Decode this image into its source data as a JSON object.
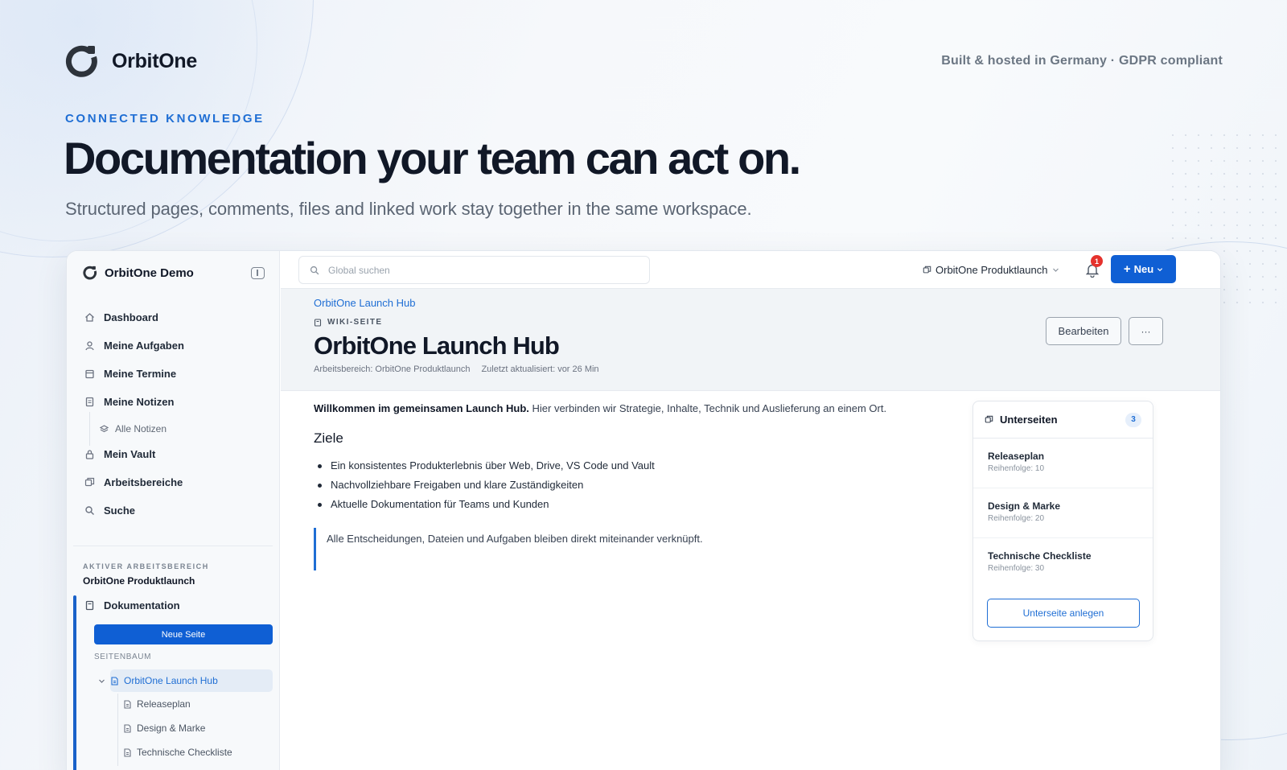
{
  "brand": {
    "name": "OrbitOne",
    "tagline": "Built & hosted in Germany · GDPR compliant"
  },
  "hero": {
    "eyebrow": "CONNECTED KNOWLEDGE",
    "title": "Documentation your team can act on.",
    "subtitle": "Structured pages, comments, files and linked work stay together in the same workspace."
  },
  "app": {
    "sidebar": {
      "title": "OrbitOne Demo",
      "nav": [
        {
          "label": "Dashboard",
          "icon": "home-icon"
        },
        {
          "label": "Meine Aufgaben",
          "icon": "user-icon"
        },
        {
          "label": "Meine Termine",
          "icon": "calendar-icon"
        },
        {
          "label": "Meine Notizen",
          "icon": "note-icon"
        },
        {
          "label": "Alle Notizen",
          "icon": "layers-icon"
        },
        {
          "label": "Mein Vault",
          "icon": "lock-icon"
        },
        {
          "label": "Arbeitsbereiche",
          "icon": "workspace-icon"
        },
        {
          "label": "Suche",
          "icon": "search-icon"
        }
      ],
      "active_workspace_label": "AKTIVER ARBEITSBEREICH",
      "active_workspace_name": "OrbitOne Produktlaunch",
      "section": "Dokumentation",
      "new_page": "Neue Seite",
      "tree_label": "SEITENBAUM",
      "tree": [
        {
          "label": "OrbitOne Launch Hub",
          "active": true
        },
        {
          "label": "Releaseplan"
        },
        {
          "label": "Design & Marke"
        },
        {
          "label": "Technische Checkliste"
        }
      ]
    },
    "topnav": {
      "search_placeholder": "Global suchen",
      "workspace": "OrbitOne Produktlaunch",
      "notifications": "1",
      "new_button": "Neu"
    },
    "page": {
      "breadcrumb": "OrbitOne Launch Hub",
      "type": "WIKI-SEITE",
      "title": "OrbitOne Launch Hub",
      "workspace_meta": "Arbeitsbereich: OrbitOne Produktlaunch",
      "updated_meta": "Zuletzt aktualisiert: vor 26 Min",
      "edit": "Bearbeiten",
      "more": "···",
      "intro_bold": "Willkommen im gemeinsamen Launch Hub.",
      "intro_rest": " Hier verbinden wir Strategie, Inhalte, Technik und Auslieferung an einem Ort.",
      "goals_heading": "Ziele",
      "goals": [
        "Ein konsistentes Produkterlebnis über Web, Drive, VS Code und Vault",
        "Nachvollziehbare Freigaben und klare Zuständigkeiten",
        "Aktuelle Dokumentation für Teams und Kunden"
      ],
      "quote": "Alle Entscheidungen, Dateien und Aufgaben bleiben direkt miteinander verknüpft."
    },
    "subpages": {
      "title": "Unterseiten",
      "count": "3",
      "items": [
        {
          "title": "Releaseplan",
          "order": "Reihenfolge: 10"
        },
        {
          "title": "Design & Marke",
          "order": "Reihenfolge: 20"
        },
        {
          "title": "Technische Checkliste",
          "order": "Reihenfolge: 30"
        }
      ],
      "create": "Unterseite anlegen"
    }
  },
  "colors": {
    "accent": "#0f5fd4",
    "link": "#1f6ed4",
    "badge": "#e5322d"
  }
}
